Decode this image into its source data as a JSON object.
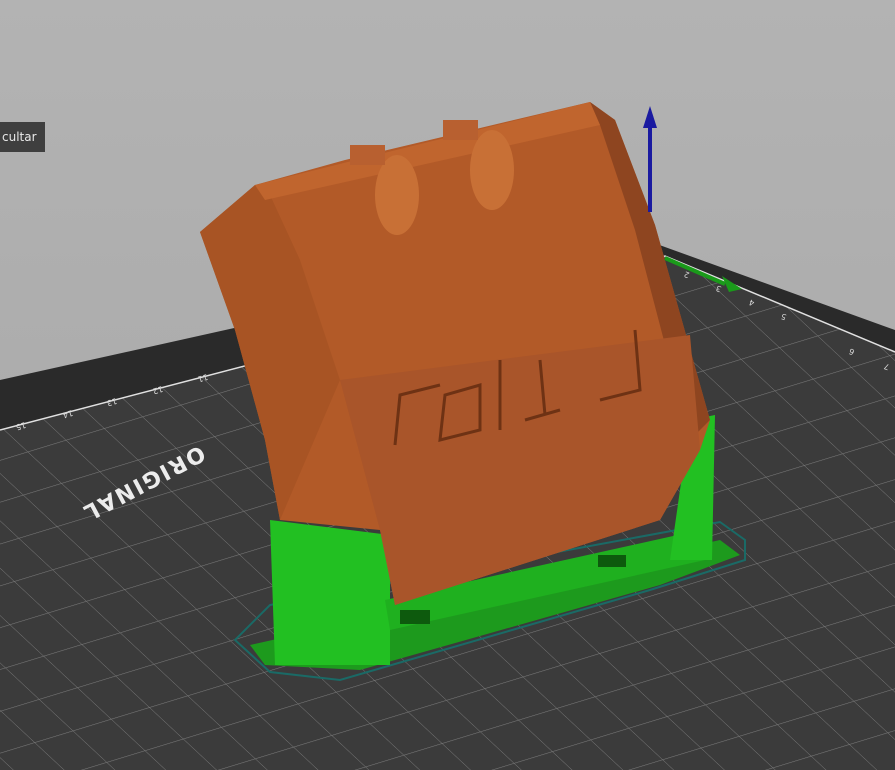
{
  "tooltip": {
    "text": "cultar"
  },
  "bed": {
    "brand_text": "ORIGINAL",
    "x_labels": [
      "15",
      "14",
      "13",
      "12",
      "11"
    ],
    "y_labels": [
      "2",
      "3",
      "4",
      "5",
      "6",
      "7"
    ]
  },
  "colors": {
    "object": "#b05a28",
    "support": "#22c022",
    "bed": "#3b3b3b",
    "background": "#aaaaaa",
    "z_axis": "#1a1aa0",
    "y_axis": "#1a9a1a"
  }
}
